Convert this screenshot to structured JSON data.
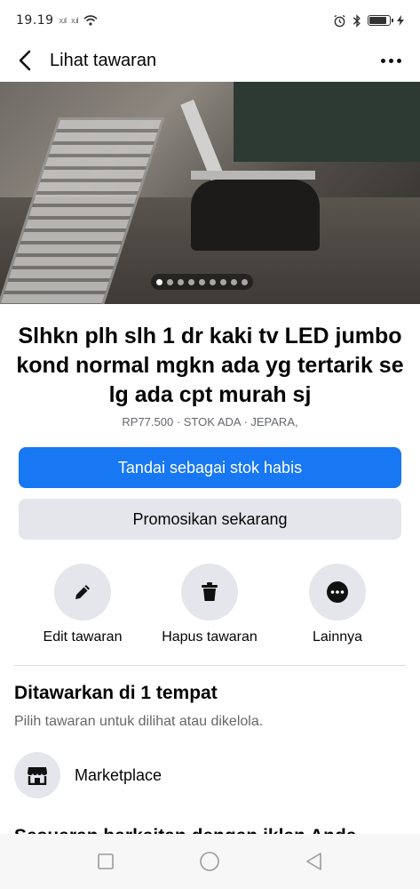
{
  "status_bar": {
    "time": "19.19",
    "signal_1": "x.ıl",
    "signal_2": "x.ıl",
    "battery_level": 0.85
  },
  "app_bar": {
    "title": "Lihat tawaran"
  },
  "hero": {
    "image_count": 9,
    "active_index": 0
  },
  "listing": {
    "title": "Slhkn plh slh 1 dr kaki tv LED jumbo kond normal mgkn ada yg tertarik se lg ada cpt murah sj",
    "meta": "RP77.500 · STOK ADA · JEPARA,"
  },
  "buttons": {
    "mark_sold": "Tandai sebagai stok habis",
    "promote": "Promosikan sekarang"
  },
  "actions": {
    "edit": "Edit tawaran",
    "delete": "Hapus tawaran",
    "more": "Lainnya"
  },
  "offered_section": {
    "title": "Ditawarkan di 1 tempat",
    "subtitle": "Pilih tawaran untuk dilihat atau dikelola.",
    "places": [
      {
        "label": "Marketplace",
        "icon": "storefront-icon"
      }
    ]
  },
  "next_section": {
    "title_cut": "Sesuaran barkaitan dengan iklan Anda"
  },
  "colors": {
    "primary": "#1877f2",
    "secondary_bg": "#e4e6eb",
    "meta_text": "#65676b"
  }
}
